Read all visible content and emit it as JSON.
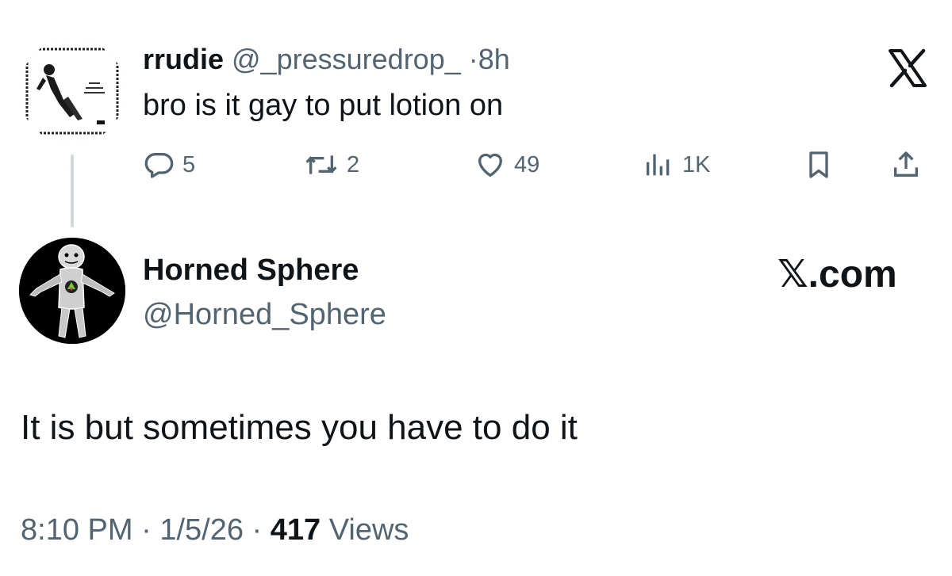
{
  "parent_tweet": {
    "display_name": "rrudie",
    "handle": "@_pressuredrop_",
    "separator": "·",
    "time_ago": "8h",
    "text": "bro is it gay to put lotion on",
    "actions": {
      "reply": {
        "icon": "reply-icon",
        "count": "5"
      },
      "retweet": {
        "icon": "retweet-icon",
        "count": "2"
      },
      "like": {
        "icon": "heart-icon",
        "count": "49"
      },
      "views": {
        "icon": "views-chart-icon",
        "count": "1K"
      },
      "bookmark": {
        "icon": "bookmark-icon"
      },
      "share": {
        "icon": "share-icon"
      }
    },
    "brand_icon": "x-logo-icon"
  },
  "reply_tweet": {
    "display_name": "Horned Sphere",
    "handle": "@Horned_Sphere",
    "brand_text": "𝕏.com",
    "text": "It is but sometimes you have to do it",
    "time": "8:10 PM",
    "separator": "·",
    "date": "1/5/26",
    "views_count": "417",
    "views_label": "Views"
  },
  "colors": {
    "text_primary": "#0f1419",
    "text_secondary": "#536471",
    "thread_line": "#cfd9de"
  }
}
